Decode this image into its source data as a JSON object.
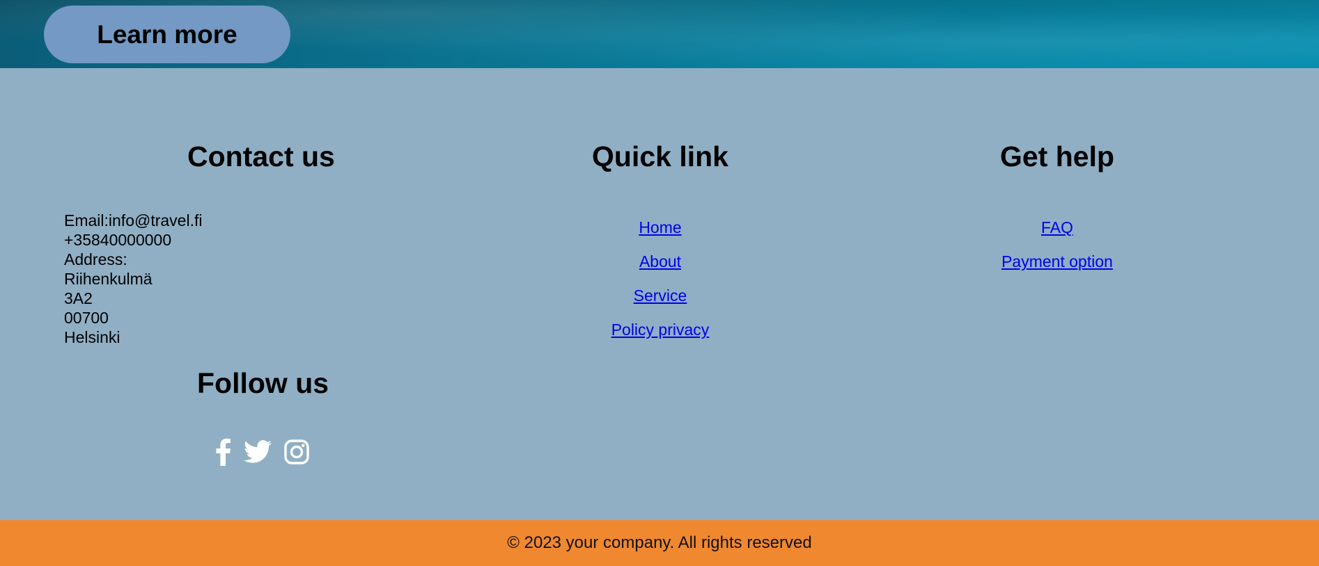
{
  "hero": {
    "learn_more_label": "Learn more"
  },
  "contact": {
    "title": "Contact us",
    "lines": [
      "Email:info@travel.fi",
      "+35840000000",
      "Address:",
      "Riihenkulmä",
      "3A2",
      "00700",
      "Helsinki"
    ]
  },
  "follow": {
    "title": "Follow us",
    "icons": [
      "facebook-icon",
      "twitter-icon",
      "instagram-icon"
    ]
  },
  "quick_link": {
    "title": "Quick link",
    "links": [
      "Home",
      "About",
      "Service",
      "Policy privacy"
    ]
  },
  "get_help": {
    "title": "Get help",
    "links": [
      "FAQ",
      "Payment option"
    ]
  },
  "footer": {
    "copyright": "© 2023 your company. All rights reserved"
  },
  "colors": {
    "footer_bg": "#90afc4",
    "button_bg": "#7399c4",
    "copyright_bg": "#f08830",
    "link": "#0000ee"
  }
}
